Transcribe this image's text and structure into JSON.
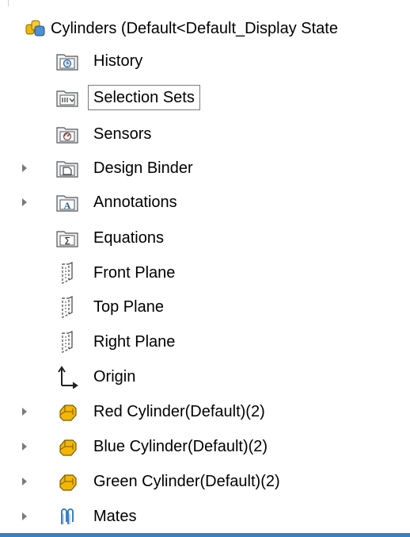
{
  "tree": {
    "root": {
      "label": "Cylinders  (Default<Default_Display State",
      "icon": "assembly-icon"
    },
    "items": [
      {
        "label": "History",
        "icon": "history-folder-icon",
        "expandable": false
      },
      {
        "label": "Selection Sets",
        "icon": "selection-sets-folder-icon",
        "expandable": false,
        "selected": true
      },
      {
        "label": "Sensors",
        "icon": "sensors-folder-icon",
        "expandable": false
      },
      {
        "label": "Design Binder",
        "icon": "design-binder-folder-icon",
        "expandable": true
      },
      {
        "label": "Annotations",
        "icon": "annotations-folder-icon",
        "expandable": true
      },
      {
        "label": "Equations",
        "icon": "equations-folder-icon",
        "expandable": false
      },
      {
        "label": "Front Plane",
        "icon": "plane-icon",
        "expandable": false
      },
      {
        "label": "Top Plane",
        "icon": "plane-icon",
        "expandable": false
      },
      {
        "label": "Right Plane",
        "icon": "plane-icon",
        "expandable": false
      },
      {
        "label": "Origin",
        "icon": "origin-icon",
        "expandable": false
      },
      {
        "label": "Red Cylinder(Default)(2)",
        "icon": "part-icon",
        "expandable": true
      },
      {
        "label": "Blue Cylinder(Default)(2)",
        "icon": "part-icon",
        "expandable": true
      },
      {
        "label": "Green Cylinder(Default)(2)",
        "icon": "part-icon",
        "expandable": true
      },
      {
        "label": "Mates",
        "icon": "mates-icon",
        "expandable": true
      }
    ]
  },
  "colors": {
    "accent": "#3c7ec2",
    "part_yellow": "#f2b705",
    "arrow": "#7a7a7a"
  }
}
